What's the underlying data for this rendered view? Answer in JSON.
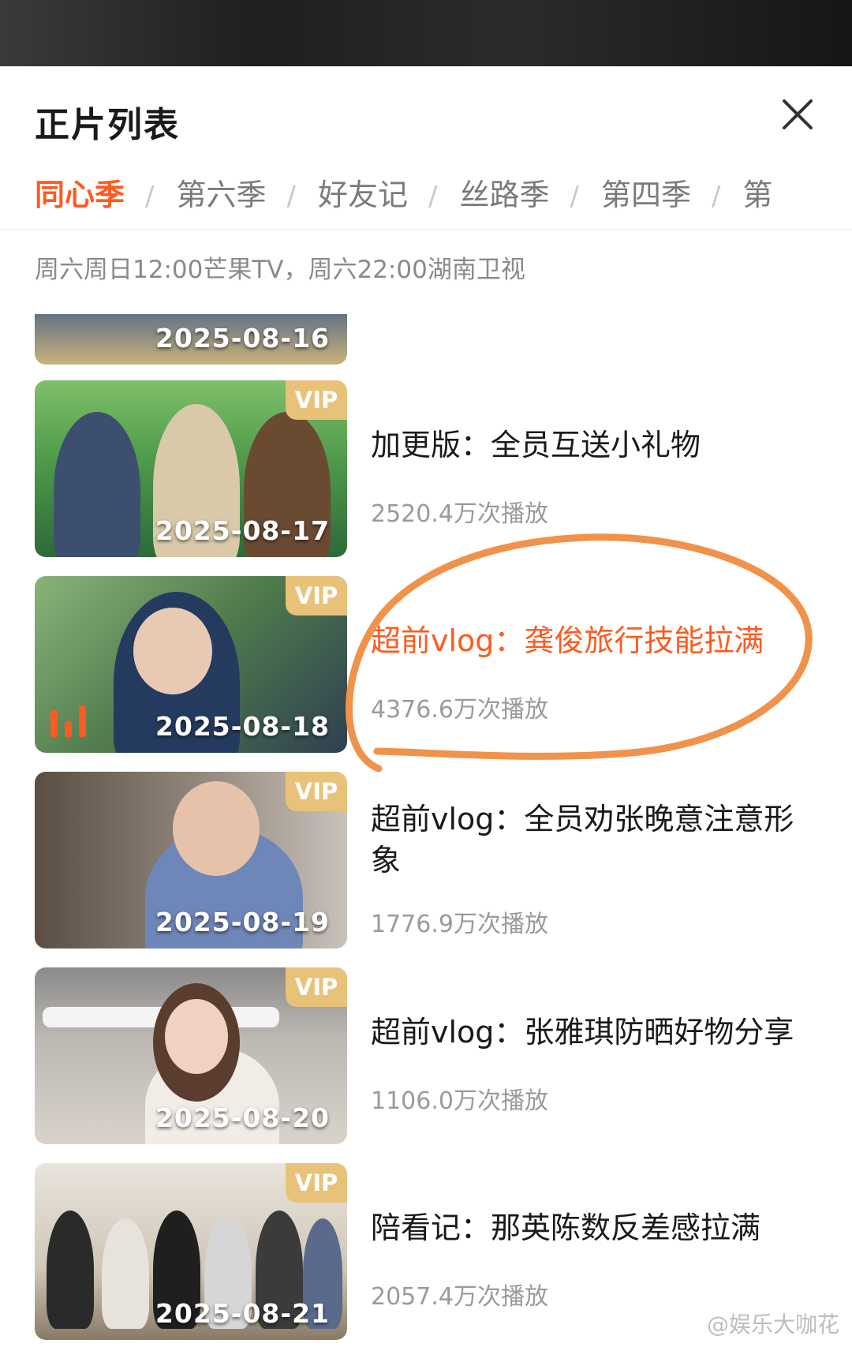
{
  "panel": {
    "title": "正片列表",
    "close_icon": "close-icon"
  },
  "tabs": [
    {
      "label": "同心季",
      "active": true
    },
    {
      "label": "第六季",
      "active": false
    },
    {
      "label": "好友记",
      "active": false
    },
    {
      "label": "丝路季",
      "active": false
    },
    {
      "label": "第四季",
      "active": false
    },
    {
      "label": "第",
      "active": false
    }
  ],
  "tab_separator": "/",
  "schedule": "周六周日12:00芒果TV，周六22:00湖南卫视",
  "episodes": [
    {
      "date": "2025-08-16",
      "vip": "",
      "title": "",
      "views": ""
    },
    {
      "date": "2025-08-17",
      "vip": "VIP",
      "title": "加更版：全员互送小礼物",
      "views": "2520.4万次播放"
    },
    {
      "date": "2025-08-18",
      "vip": "VIP",
      "title": "超前vlog：龚俊旅行技能拉满",
      "views": "4376.6万次播放",
      "playing": true
    },
    {
      "date": "2025-08-19",
      "vip": "VIP",
      "title": "超前vlog：全员劝张晚意注意形象",
      "views": "1776.9万次播放"
    },
    {
      "date": "2025-08-20",
      "vip": "VIP",
      "title": "超前vlog：张雅琪防晒好物分享",
      "views": "1106.0万次播放"
    },
    {
      "date": "2025-08-21",
      "vip": "VIP",
      "title": "陪看记：那英陈数反差感拉满",
      "views": "2057.4万次播放"
    }
  ],
  "colors": {
    "accent": "#ff5a1f",
    "vip_badge": "#e9c27a",
    "circle_annotation": "#f0924a"
  },
  "watermark": "@娱乐大咖花"
}
